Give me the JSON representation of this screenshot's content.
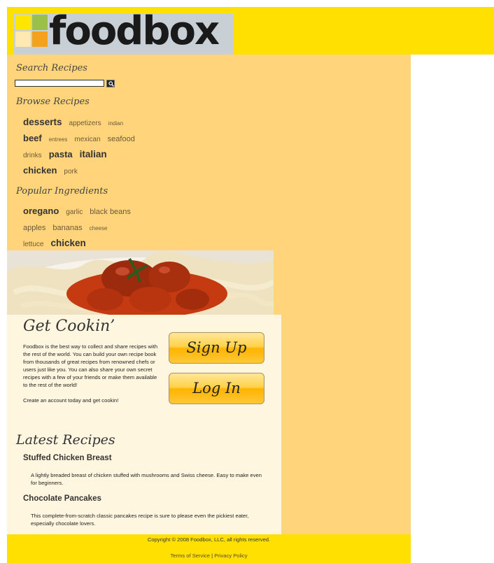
{
  "brand": {
    "name": "foodbox",
    "colors": {
      "header": "#ffe000",
      "sidebar": "#ffd47a",
      "content": "#fff6e0"
    }
  },
  "search": {
    "title": "Search Recipes",
    "placeholder": "",
    "value": "",
    "button_icon": "magnifier-icon"
  },
  "browse": {
    "title": "Browse Recipes",
    "rows": [
      [
        {
          "label": "desserts",
          "size": "xl"
        },
        {
          "label": "appetizers",
          "size": "s"
        },
        {
          "label": "indian",
          "size": "xs"
        }
      ],
      [
        {
          "label": "beef",
          "size": "l"
        },
        {
          "label": "entrees",
          "size": "xs"
        },
        {
          "label": "mexican",
          "size": "s"
        },
        {
          "label": "seafood",
          "size": "m"
        }
      ],
      [
        {
          "label": "drinks",
          "size": "s"
        },
        {
          "label": "pasta",
          "size": "l"
        },
        {
          "label": "italian",
          "size": "xl"
        }
      ],
      [
        {
          "label": "chicken",
          "size": "l"
        },
        {
          "label": "pork",
          "size": "s"
        }
      ]
    ]
  },
  "ingredients": {
    "title": "Popular Ingredients",
    "rows": [
      [
        {
          "label": "oregano",
          "size": "l"
        },
        {
          "label": "garlic",
          "size": "s"
        },
        {
          "label": "black beans",
          "size": "m"
        }
      ],
      [
        {
          "label": "apples",
          "size": "m"
        },
        {
          "label": "bananas",
          "size": "m"
        },
        {
          "label": "cheese",
          "size": "xs"
        }
      ],
      [
        {
          "label": "lettuce",
          "size": "s"
        },
        {
          "label": "chicken",
          "size": "xl"
        }
      ]
    ]
  },
  "intro": {
    "title": "Get Cookin’",
    "paragraph1": "Foodbox is the best way to collect and share recipes with the rest of the world. You can build your own recipe book from thousands of great recipes from renowned chefs or users just like you. You can also share your own secret recipes with a few of your friends or make them available to the rest of the world!",
    "paragraph2": "Create an account today and get cookin!",
    "signup_label": "Sign Up",
    "login_label": "Log In"
  },
  "latest": {
    "title": "Latest Recipes",
    "recipes": [
      {
        "title": "Stuffed Chicken Breast",
        "description": "A lightly breaded breast of chicken stuffed with mushrooms and Swiss cheese. Easy to make even for beginners."
      },
      {
        "title": "Chocolate Pancakes",
        "description": "This complete-from-scratch classic pancakes recipe is sure to please even the pickiest eater, especially chocolate lovers."
      }
    ]
  },
  "footer": {
    "copyright": "Copyright © 2008 Foodbox, LLC, all rights reserved.",
    "terms": "Terms of Service",
    "separator": " | ",
    "privacy": "Privacy Policy"
  }
}
